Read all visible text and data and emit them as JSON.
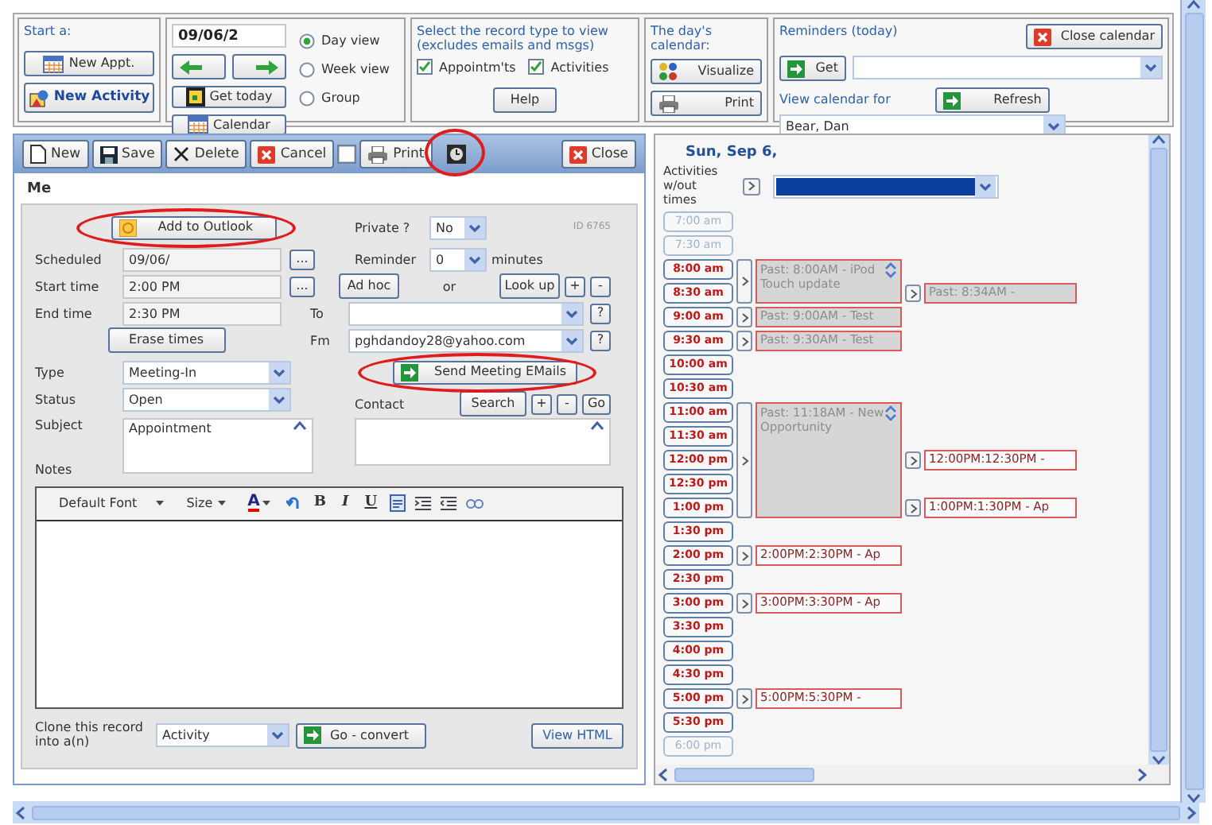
{
  "start_panel": {
    "label": "Start a:",
    "new_appt": "New Appt.",
    "new_activity": "New Activity"
  },
  "date_panel": {
    "date": "09/06/2",
    "get_today": "Get today",
    "calendar": "Calendar",
    "views": [
      {
        "label": "Day view",
        "selected": true
      },
      {
        "label": "Week view",
        "selected": false
      },
      {
        "label": "Group",
        "selected": false
      }
    ]
  },
  "record_types": {
    "caption": "Select the record type to view (excludes emails and msgs)",
    "options": [
      {
        "label": "Appointm'ts",
        "checked": true
      },
      {
        "label": "Activities",
        "checked": true
      }
    ],
    "help": "Help"
  },
  "day_calendar": {
    "caption": "The day's calendar:",
    "visualize": "Visualize",
    "print": "Print"
  },
  "reminders": {
    "title": "Reminders (today)",
    "close": "Close calendar",
    "get": "Get",
    "view_for": "View calendar for",
    "refresh": "Refresh",
    "person": "Bear, Dan"
  },
  "toolbar": {
    "new": "New",
    "save": "Save",
    "delete": "Delete",
    "cancel": "Cancel",
    "checked": false,
    "print": "Print",
    "clock_highlighted": true,
    "close": "Close"
  },
  "record": {
    "owner": "Me",
    "add_to_outlook": "Add to Outlook",
    "add_highlighted": true,
    "private_label": "Private ?",
    "private": "No",
    "id": "ID 6765",
    "scheduled_label": "Scheduled",
    "scheduled": "09/06/",
    "pick_1": "...",
    "start_label": "Start time",
    "start": "2:00 PM",
    "pick_2": "...",
    "end_label": "End time",
    "end": "2:30 PM",
    "erase": "Erase times",
    "reminder_label": "Reminder",
    "reminder": "0",
    "minutes": "minutes",
    "ad_hoc": "Ad hoc",
    "or": "or",
    "look_up": "Look up",
    "add_1": "+",
    "remove_1": "-",
    "to_label": "To",
    "help_1": "?",
    "fm_label": "Fm",
    "fm": "pghdandoy28@yahoo.com",
    "help_2": "?",
    "send": "Send Meeting EMails",
    "send_highlighted": true,
    "type_label": "Type",
    "type": "Meeting-In",
    "status_label": "Status",
    "status": "Open",
    "subject_label": "Subject",
    "subject": "Appointment",
    "notes_label": "Notes",
    "contact_label": "Contact",
    "search": "Search",
    "add_2": "+",
    "remove_2": "-",
    "go": "Go"
  },
  "editor": {
    "font": "Default Font",
    "size": "Size",
    "font_tint_letter": "A",
    "bold": "B",
    "italic": "I",
    "underline": "U"
  },
  "clone": {
    "label": "Clone this record into a(n)",
    "type": "Activity",
    "go": "Go - convert",
    "view_html": "View HTML"
  },
  "calendar": {
    "date": "Sun, Sep 6,",
    "no_time_label": "Activities w/out times",
    "slots": [
      {
        "kind": "slot",
        "time": "7:00 am",
        "dimmed": true
      },
      {
        "kind": "slot",
        "time": "7:30 am",
        "dimmed": true
      },
      {
        "kind": "group",
        "event": {
          "text": "Past: 8:00AM - iPod Touch update",
          "past": true
        },
        "slots": [
          {
            "time": "8:00 am",
            "dimmed": false
          },
          {
            "time": "8:30 am",
            "dimmed": false,
            "side_event": {
              "text": "Past: 8:34AM -",
              "past": true
            }
          }
        ]
      },
      {
        "kind": "slot",
        "time": "9:00 am",
        "dimmed": false,
        "event": {
          "text": "Past: 9:00AM - Test",
          "past": true
        }
      },
      {
        "kind": "slot",
        "time": "9:30 am",
        "dimmed": false,
        "event": {
          "text": "Past: 9:30AM - Test",
          "past": true
        }
      },
      {
        "kind": "slot",
        "time": "10:00 am",
        "dimmed": false
      },
      {
        "kind": "slot",
        "time": "10:30 am",
        "dimmed": false
      },
      {
        "kind": "group",
        "event": {
          "text": "Past: 11:18AM - New Opportunity",
          "past": true
        },
        "slots": [
          {
            "time": "11:00 am",
            "dimmed": false
          },
          {
            "time": "11:30 am",
            "dimmed": false
          },
          {
            "time": "12:00 pm",
            "dimmed": false,
            "side_event": {
              "text": "12:00PM:12:30PM -",
              "past": false
            }
          },
          {
            "time": "12:30 pm",
            "dimmed": false
          },
          {
            "time": "1:00 pm",
            "dimmed": false,
            "side_event": {
              "text": "1:00PM:1:30PM - Ap",
              "past": false
            }
          }
        ]
      },
      {
        "kind": "slot",
        "time": "1:30 pm",
        "dimmed": false
      },
      {
        "kind": "slot",
        "time": "2:00 pm",
        "dimmed": false,
        "event": {
          "text": "2:00PM:2:30PM - Ap",
          "past": false
        }
      },
      {
        "kind": "slot",
        "time": "2:30 pm",
        "dimmed": false
      },
      {
        "kind": "slot",
        "time": "3:00 pm",
        "dimmed": false,
        "event": {
          "text": "3:00PM:3:30PM - Ap",
          "past": false
        }
      },
      {
        "kind": "slot",
        "time": "3:30 pm",
        "dimmed": false
      },
      {
        "kind": "slot",
        "time": "4:00 pm",
        "dimmed": false
      },
      {
        "kind": "slot",
        "time": "4:30 pm",
        "dimmed": false
      },
      {
        "kind": "slot",
        "time": "5:00 pm",
        "dimmed": false,
        "event": {
          "text": "5:00PM:5:30PM -",
          "past": false
        }
      },
      {
        "kind": "slot",
        "time": "5:30 pm",
        "dimmed": false
      },
      {
        "kind": "slot",
        "time": "6:00 pm",
        "dimmed": true
      }
    ]
  }
}
